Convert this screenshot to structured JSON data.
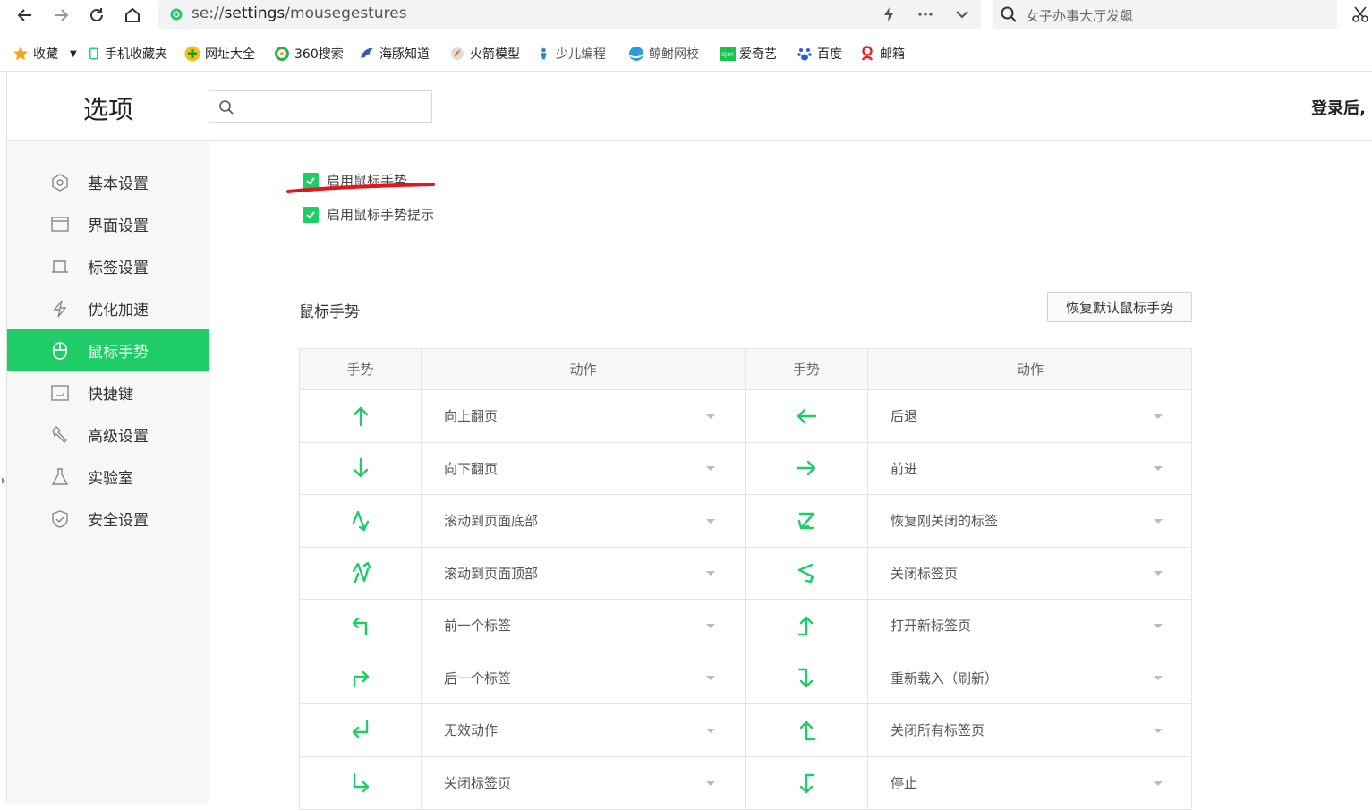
{
  "browser": {
    "url_prefix": "se://",
    "url_main": "settings",
    "url_rest": "/mousegestures",
    "search_text": "女子办事大厅发飙"
  },
  "bookmarks": [
    {
      "label": "收藏",
      "icon": "star-icon",
      "color": "#f5a623"
    },
    {
      "label": "手机收藏夹",
      "icon": "phone-icon",
      "color": "#1fcc67"
    },
    {
      "label": "网址大全",
      "icon": "plus-circle-icon",
      "color": "#3fa73f"
    },
    {
      "label": "360搜索",
      "icon": "search-360-icon",
      "color": "#27b24a"
    },
    {
      "label": "海豚知道",
      "icon": "dolphin-icon",
      "color": "#3b5ab8"
    },
    {
      "label": "火箭模型",
      "icon": "rocket-icon",
      "color": "#e07a2e"
    },
    {
      "label": "少儿编程",
      "icon": "kid-icon",
      "color": "#2b86d9"
    },
    {
      "label": "鲸鲋网校",
      "icon": "whale-icon",
      "color": "#2e9ae0"
    },
    {
      "label": "爱奇艺",
      "icon": "iqiyi-icon",
      "color": "#19c34a"
    },
    {
      "label": "百度",
      "icon": "baidu-paw-icon",
      "color": "#2d5be3"
    },
    {
      "label": "邮箱",
      "icon": "mail-icon",
      "color": "#e02424"
    }
  ],
  "header": {
    "title": "选项",
    "search_placeholder": "",
    "login_text": "登录后,"
  },
  "sidebar": {
    "items": [
      {
        "label": "基本设置",
        "icon": "hexagon-gear-icon"
      },
      {
        "label": "界面设置",
        "icon": "window-icon"
      },
      {
        "label": "标签设置",
        "icon": "tab-icon"
      },
      {
        "label": "优化加速",
        "icon": "lightning-icon"
      },
      {
        "label": "鼠标手势",
        "icon": "mouse-icon",
        "active": true
      },
      {
        "label": "快捷键",
        "icon": "keyboard-icon"
      },
      {
        "label": "高级设置",
        "icon": "wrench-icon"
      },
      {
        "label": "实验室",
        "icon": "flask-icon"
      },
      {
        "label": "安全设置",
        "icon": "shield-check-icon"
      }
    ]
  },
  "options": {
    "enable_gestures": "启用鼠标手势",
    "enable_gesture_hints": "启用鼠标手势提示"
  },
  "gestures": {
    "section_title": "鼠标手势",
    "restore_button": "恢复默认鼠标手势",
    "col_gesture": "手势",
    "col_action": "动作",
    "rows": [
      {
        "left_icon": "arrow-up-icon",
        "left_action": "向上翻页",
        "right_icon": "arrow-left-icon",
        "right_action": "后退"
      },
      {
        "left_icon": "arrow-down-icon",
        "left_action": "向下翻页",
        "right_icon": "arrow-right-icon",
        "right_action": "前进"
      },
      {
        "left_icon": "zigzag-down-icon",
        "left_action": "滚动到页面底部",
        "right_icon": "z-shape-icon",
        "right_action": "恢复刚关闭的标签"
      },
      {
        "left_icon": "zigzag-up-icon",
        "left_action": "滚动到页面顶部",
        "right_icon": "reverse-z-icon",
        "right_action": "关闭标签页"
      },
      {
        "left_icon": "up-then-left-icon",
        "left_action": "前一个标签",
        "right_icon": "left-then-up-icon",
        "right_action": "打开新标签页"
      },
      {
        "left_icon": "up-then-right-icon",
        "left_action": "后一个标签",
        "right_icon": "right-then-down-icon",
        "right_action": "重新载入（刷新）"
      },
      {
        "left_icon": "down-then-left-icon",
        "left_action": "无效动作",
        "right_icon": "right-then-up-icon",
        "right_action": "关闭所有标签页"
      },
      {
        "left_icon": "down-then-right-icon",
        "left_action": "关闭标签页",
        "right_icon": "left-then-down-icon",
        "right_action": "停止"
      }
    ]
  },
  "colors": {
    "accent": "#1fcc67",
    "annotation": "#e8141c"
  }
}
